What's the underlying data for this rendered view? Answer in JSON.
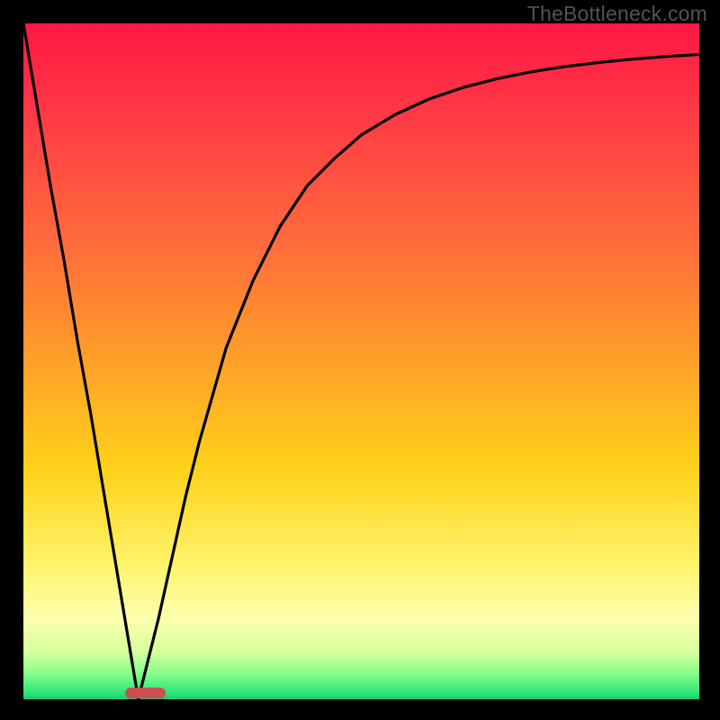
{
  "watermark": "TheBottleneck.com",
  "colors": {
    "page_bg": "#000000",
    "curve": "#000000",
    "bar": "#cc4e51",
    "gradient_stops": [
      "#ff1744",
      "#ff3b45",
      "#ff6a3c",
      "#ffa028",
      "#ffd21a",
      "#fff36a",
      "#fdffad",
      "#d5ff9d",
      "#8bff8b",
      "#2ee67a",
      "#1ac86a"
    ]
  },
  "chart_data": {
    "type": "line",
    "title": "",
    "xlabel": "",
    "ylabel": "",
    "xlim": [
      0,
      100
    ],
    "ylim": [
      0,
      100
    ],
    "x": [
      0,
      2,
      4,
      6,
      8,
      10,
      12,
      14,
      16,
      17,
      18,
      19,
      20,
      22,
      24,
      26,
      28,
      30,
      34,
      38,
      42,
      46,
      50,
      55,
      60,
      65,
      70,
      75,
      80,
      85,
      90,
      95,
      100
    ],
    "y": [
      100,
      88,
      76,
      65,
      53,
      42,
      30,
      18,
      6,
      0,
      4,
      8,
      12,
      21,
      30,
      38,
      45,
      52,
      62,
      70,
      76,
      80,
      83.5,
      86.5,
      88.8,
      90.5,
      91.8,
      92.8,
      93.6,
      94.2,
      94.7,
      95.1,
      95.4
    ],
    "marker": {
      "x_start": 15,
      "x_end": 21,
      "color": "#cc4e51"
    }
  }
}
